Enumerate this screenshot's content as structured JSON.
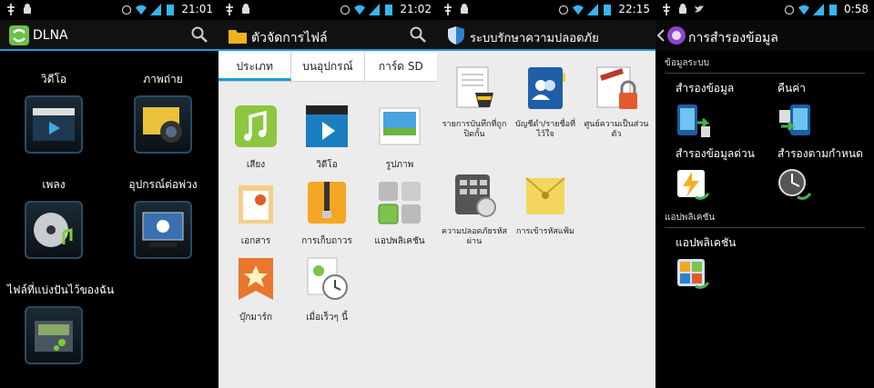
{
  "panels": [
    {
      "clock": "21:01",
      "title": "DLNA",
      "items": [
        {
          "label": "วิดีโอ"
        },
        {
          "label": "ภาพถ่าย"
        },
        {
          "label": "เพลง"
        },
        {
          "label": "อุปกรณ์ต่อพ่วง"
        },
        {
          "label": "ไฟล์ที่แบ่งปันไว้ของฉัน"
        }
      ]
    },
    {
      "clock": "21:02",
      "title": "ตัวจัดการไฟล์",
      "tabs": [
        "ประเภท",
        "บนอุปกรณ์",
        "การ์ด SD"
      ],
      "items": [
        {
          "label": "เสียง"
        },
        {
          "label": "วิดีโอ"
        },
        {
          "label": "รูปภาพ"
        },
        {
          "label": "เอกสาร"
        },
        {
          "label": "การเก็บถาวร"
        },
        {
          "label": "แอปพลิเคชัน"
        },
        {
          "label": "บุ๊กมาร์ก"
        },
        {
          "label": "เมื่อเร็วๆ นี้"
        }
      ]
    },
    {
      "clock": "22:15",
      "title": "ระบบรักษาความปลอดภัย",
      "items": [
        {
          "label": "รายการบันทึกที่ถูกปิดกั้น"
        },
        {
          "label": "บัญชีดำ/รายชื่อที่ไว้ใจ"
        },
        {
          "label": "ศูนย์ความเป็นส่วนตัว"
        },
        {
          "label": "ความปลอดภัยรหัสผ่าน"
        },
        {
          "label": "การเข้ารหัสแฟ้ม"
        }
      ]
    },
    {
      "clock": "0:58",
      "title": "การสำรองข้อมูล",
      "section_system": "ข้อมูลระบบ",
      "section_apps": "แอปพลิเคชัน",
      "items": [
        {
          "label": "สำรองข้อมูล"
        },
        {
          "label": "คืนค่า"
        },
        {
          "label": "สำรองข้อมูลด่วน"
        },
        {
          "label": "สำรองตามกำหนด"
        },
        {
          "label": "แอปพลิเคชัน"
        }
      ]
    }
  ],
  "colors": {
    "accent": "#1a9bd7",
    "dark_bg": "#000000",
    "light_bg": "#ececec"
  }
}
